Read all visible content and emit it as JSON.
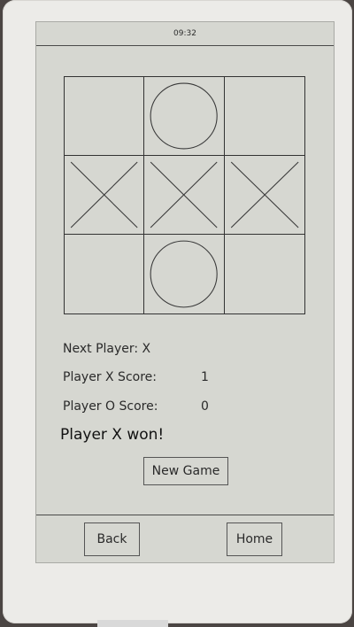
{
  "status": {
    "time": "09:32"
  },
  "board": {
    "cells": [
      "",
      "O",
      "",
      "X",
      "X",
      "X",
      "",
      "O",
      ""
    ]
  },
  "info": {
    "next_player_label": "Next Player: X",
    "x_score_label": "Player X Score:",
    "x_score_value": "1",
    "o_score_label": "Player O Score:",
    "o_score_value": "0",
    "result": "Player X won!"
  },
  "actions": {
    "new_game": "New Game"
  },
  "nav": {
    "back": "Back",
    "home": "Home"
  }
}
